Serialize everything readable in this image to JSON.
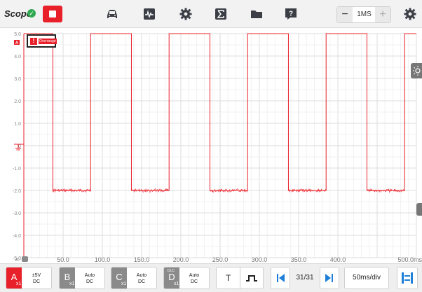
{
  "app": {
    "title": "Scope"
  },
  "toolbar": {
    "icons": [
      "stop-icon",
      "car-icon",
      "waveform-icon",
      "gear-icon",
      "sigma-icon",
      "folder-icon",
      "help-icon",
      "settings-icon"
    ],
    "zoom": {
      "minus": "−",
      "value": "1MS",
      "plus": "+"
    }
  },
  "scope": {
    "overrange_label": "Overrange",
    "channel_marker": "A",
    "y_ticks": [
      "5.0",
      "4.0",
      "3.0",
      "2.0",
      "1.0",
      "0",
      "-1.0",
      "-2.0",
      "-3.0",
      "-4.0",
      "-5.0"
    ],
    "x_ticks": [
      "0",
      "50.0",
      "100.0",
      "150.0",
      "200.0",
      "250.0",
      "300.0",
      "350.0",
      "400.0",
      "500.0ms"
    ],
    "trace_color": "#e8202a"
  },
  "chart_data": {
    "type": "line",
    "title": "",
    "xlabel": "",
    "ylabel": "",
    "xlim": [
      0,
      500
    ],
    "ylim": [
      -5,
      5
    ],
    "grid": true,
    "series": [
      {
        "x": [
          0,
          37,
          37,
          85,
          85,
          137,
          137,
          185,
          185,
          237,
          237,
          285,
          285,
          337,
          337,
          385,
          385,
          437,
          437,
          485,
          485,
          500
        ],
        "values": [
          5,
          5,
          -2,
          -2,
          5,
          5,
          -2,
          -2,
          5,
          5,
          -2,
          -2,
          5,
          5,
          -2,
          -2,
          5,
          5,
          -2,
          -2,
          5,
          5
        ]
      }
    ]
  },
  "channels": [
    {
      "tag": "A",
      "mult": "x1",
      "line1": "±5V",
      "line2": "DC",
      "color": "#e8202a",
      "dlc": ""
    },
    {
      "tag": "B",
      "mult": "x1",
      "line1": "Auto",
      "line2": "DC",
      "color": "#8a8a8a",
      "dlc": ""
    },
    {
      "tag": "C",
      "mult": "x1",
      "line1": "Auto",
      "line2": "DC",
      "color": "#8a8a8a",
      "dlc": ""
    },
    {
      "tag": "D",
      "mult": "x1",
      "line1": "Auto",
      "line2": "DC",
      "color": "#8a8a8a",
      "dlc": "DLC"
    }
  ],
  "trigger": {
    "type_label": "T"
  },
  "frames": {
    "current": "31/31"
  },
  "timebase": {
    "label": "50ms/div"
  },
  "colors": {
    "accent": "#e8202a",
    "nav_blue": "#1e7fd8",
    "channel_grey": "#8a8a8a"
  }
}
